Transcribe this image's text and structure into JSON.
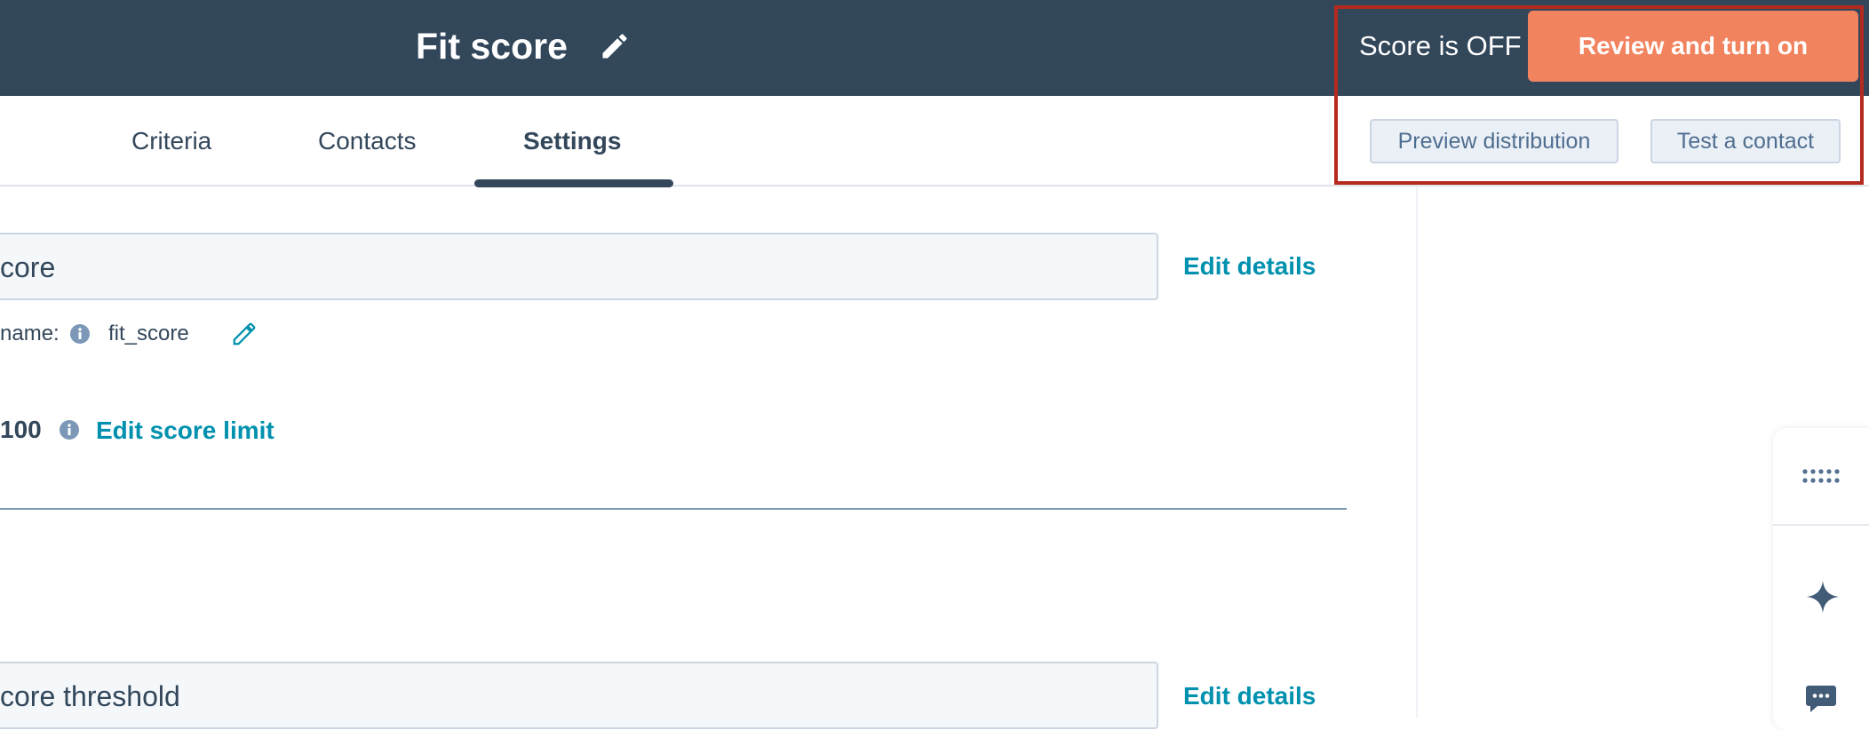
{
  "header": {
    "title": "Fit score",
    "score_status": "Score is OFF",
    "review_button_label": "Review and turn on"
  },
  "tabs": [
    {
      "label": "Criteria",
      "active": false
    },
    {
      "label": "Contacts",
      "active": false
    },
    {
      "label": "Settings",
      "active": true
    }
  ],
  "actions": {
    "preview_label": "Preview distribution",
    "test_label": "Test a contact"
  },
  "settings": {
    "name_field_value": "core",
    "edit_details_label": "Edit details",
    "internal_name_label": "name:",
    "internal_name_value": "fit_score",
    "score_limit_value": "100",
    "edit_score_limit_label": "Edit score limit",
    "threshold_field_value": "core threshold",
    "edit_details_label_2": "Edit details"
  },
  "icons": {
    "title_edit": "pencil-icon",
    "internal_name_edit": "pencil-icon",
    "info": "info-icon",
    "apps": "apps-grid-icon",
    "ai": "sparkle-icon",
    "chat": "chat-icon"
  },
  "colors": {
    "header_bg": "#33475b",
    "primary_button": "#f2835f",
    "link": "#0091ae",
    "highlight": "#b52a1f",
    "secondary_button_bg": "#eaf0f6"
  }
}
